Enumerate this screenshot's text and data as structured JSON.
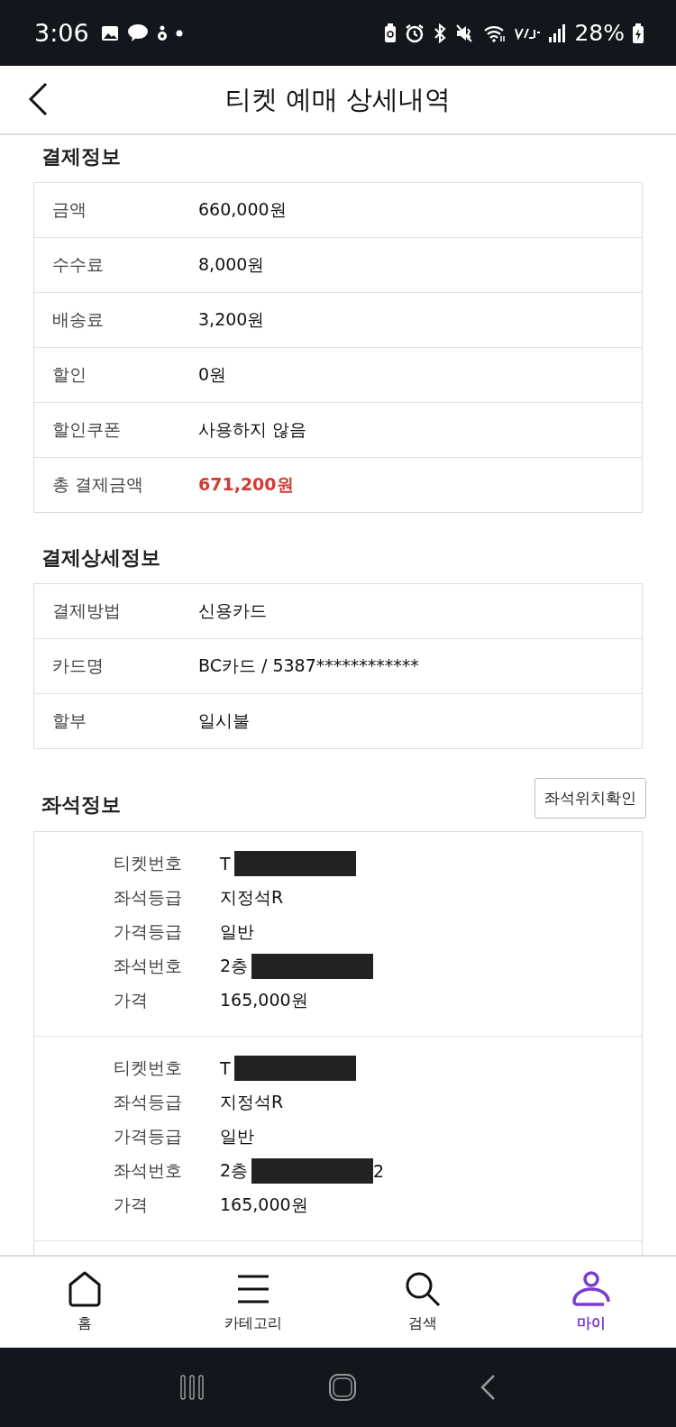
{
  "status_bar": {
    "time": "3:06",
    "battery": "28%"
  },
  "header": {
    "title": "티켓 예매 상세내역"
  },
  "payment": {
    "title": "결제정보",
    "rows": [
      {
        "label": "금액",
        "value": "660,000원",
        "highlight": false
      },
      {
        "label": "수수료",
        "value": "8,000원",
        "highlight": false
      },
      {
        "label": "배송료",
        "value": "3,200원",
        "highlight": false
      },
      {
        "label": "할인",
        "value": "0원",
        "highlight": false
      },
      {
        "label": "할인쿠폰",
        "value": "사용하지 않음",
        "highlight": false
      },
      {
        "label": "총 결제금액",
        "value": "671,200원",
        "highlight": true
      }
    ]
  },
  "payment_detail": {
    "title": "결제상세정보",
    "rows": [
      {
        "label": "결제방법",
        "value": "신용카드",
        "highlight": false
      },
      {
        "label": "카드명",
        "value": "BC카드 / 5387************",
        "highlight": false
      },
      {
        "label": "할부",
        "value": "일시불",
        "highlight": false
      }
    ]
  },
  "seats": {
    "title": "좌석정보",
    "button": "좌석위치확인",
    "tickets": [
      {
        "fields": [
          {
            "label": "티켓번호",
            "value": "T",
            "redacted": true
          },
          {
            "label": "좌석등급",
            "value": "지정석R",
            "redacted": false
          },
          {
            "label": "가격등급",
            "value": "일반",
            "redacted": false
          },
          {
            "label": "좌석번호",
            "value": "2층",
            "redacted": true
          },
          {
            "label": "가격",
            "value": "165,000원",
            "redacted": false
          }
        ]
      },
      {
        "fields": [
          {
            "label": "티켓번호",
            "value": "T",
            "redacted": true
          },
          {
            "label": "좌석등급",
            "value": "지정석R",
            "redacted": false
          },
          {
            "label": "가격등급",
            "value": "일반",
            "redacted": false
          },
          {
            "label": "좌석번호",
            "value": "2층",
            "redacted": true,
            "value_after": "2"
          },
          {
            "label": "가격",
            "value": "165,000원",
            "redacted": false
          }
        ]
      }
    ]
  },
  "bottom_nav": [
    {
      "kind": "home",
      "label": "홈",
      "selected": false
    },
    {
      "kind": "menu",
      "label": "카테고리",
      "selected": false
    },
    {
      "kind": "search",
      "label": "검색",
      "selected": false
    },
    {
      "kind": "person",
      "label": "마이",
      "selected": true
    }
  ]
}
